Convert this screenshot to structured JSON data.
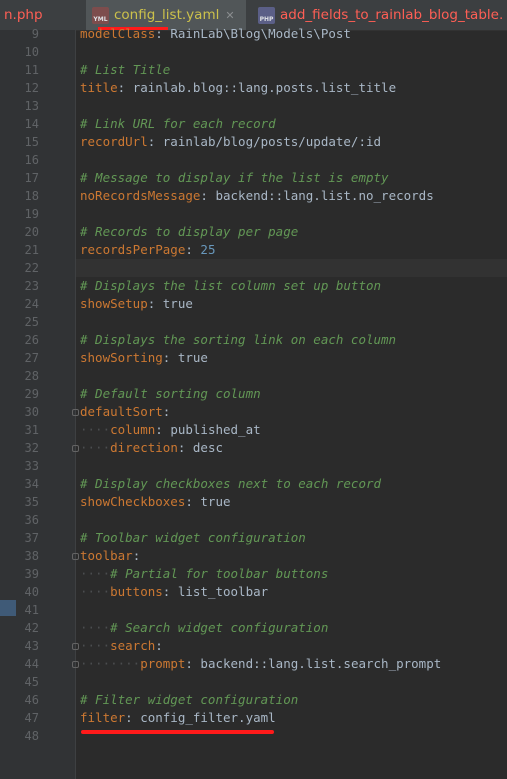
{
  "tabs": [
    {
      "label": "n.php",
      "icon": "php-file-icon"
    },
    {
      "label": "config_list.yaml",
      "icon": "yaml-file-icon",
      "active": true
    },
    {
      "label": "add_fields_to_rainlab_blog_table.",
      "icon": "php-file-icon"
    }
  ],
  "editor": {
    "current_line": 22,
    "lines": [
      {
        "n": "9",
        "parts": [
          [
            "key",
            "modelClass"
          ],
          [
            "val",
            ": RainLab\\Blog\\Models\\Post"
          ]
        ]
      },
      {
        "n": "10",
        "parts": []
      },
      {
        "n": "11",
        "parts": [
          [
            "comment",
            "# List Title"
          ]
        ]
      },
      {
        "n": "12",
        "parts": [
          [
            "key",
            "title"
          ],
          [
            "val",
            ": rainlab.blog::lang.posts.list_title"
          ]
        ]
      },
      {
        "n": "13",
        "parts": []
      },
      {
        "n": "14",
        "parts": [
          [
            "comment",
            "# Link URL for each record"
          ]
        ]
      },
      {
        "n": "15",
        "parts": [
          [
            "key",
            "recordUrl"
          ],
          [
            "val",
            ": rainlab/blog/posts/update/:id"
          ]
        ]
      },
      {
        "n": "16",
        "parts": []
      },
      {
        "n": "17",
        "parts": [
          [
            "comment",
            "# Message to display if the list is empty"
          ]
        ]
      },
      {
        "n": "18",
        "parts": [
          [
            "key",
            "noRecordsMessage"
          ],
          [
            "val",
            ": backend::lang.list.no_records"
          ]
        ]
      },
      {
        "n": "19",
        "parts": []
      },
      {
        "n": "20",
        "parts": [
          [
            "comment",
            "# Records to display per page"
          ]
        ]
      },
      {
        "n": "21",
        "parts": [
          [
            "key",
            "recordsPerPage"
          ],
          [
            "val",
            ": "
          ],
          [
            "num",
            "25"
          ]
        ]
      },
      {
        "n": "22",
        "parts": []
      },
      {
        "n": "23",
        "parts": [
          [
            "comment",
            "# Displays the list column set up button"
          ]
        ]
      },
      {
        "n": "24",
        "parts": [
          [
            "key",
            "showSetup"
          ],
          [
            "val",
            ": true"
          ]
        ]
      },
      {
        "n": "25",
        "parts": []
      },
      {
        "n": "26",
        "parts": [
          [
            "comment",
            "# Displays the sorting link on each column"
          ]
        ]
      },
      {
        "n": "27",
        "parts": [
          [
            "key",
            "showSorting"
          ],
          [
            "val",
            ": true"
          ]
        ]
      },
      {
        "n": "28",
        "parts": []
      },
      {
        "n": "29",
        "parts": [
          [
            "comment",
            "# Default sorting column"
          ]
        ]
      },
      {
        "n": "30",
        "parts": [
          [
            "key",
            "defaultSort"
          ],
          [
            "val",
            ":"
          ]
        ]
      },
      {
        "n": "31",
        "parts": [
          [
            "dots",
            "····"
          ],
          [
            "key",
            "column"
          ],
          [
            "val",
            ": published_at"
          ]
        ]
      },
      {
        "n": "32",
        "parts": [
          [
            "dots",
            "····"
          ],
          [
            "key",
            "direction"
          ],
          [
            "val",
            ": desc"
          ]
        ]
      },
      {
        "n": "33",
        "parts": []
      },
      {
        "n": "34",
        "parts": [
          [
            "comment",
            "# Display checkboxes next to each record"
          ]
        ]
      },
      {
        "n": "35",
        "parts": [
          [
            "key",
            "showCheckboxes"
          ],
          [
            "val",
            ": true"
          ]
        ]
      },
      {
        "n": "36",
        "parts": []
      },
      {
        "n": "37",
        "parts": [
          [
            "comment",
            "# Toolbar widget configuration"
          ]
        ]
      },
      {
        "n": "38",
        "parts": [
          [
            "key",
            "toolbar"
          ],
          [
            "val",
            ":"
          ]
        ]
      },
      {
        "n": "39",
        "parts": [
          [
            "dots",
            "····"
          ],
          [
            "comment",
            "# Partial for toolbar buttons"
          ]
        ]
      },
      {
        "n": "40",
        "parts": [
          [
            "dots",
            "····"
          ],
          [
            "key",
            "buttons"
          ],
          [
            "val",
            ": list_toolbar"
          ]
        ]
      },
      {
        "n": "41",
        "parts": []
      },
      {
        "n": "42",
        "parts": [
          [
            "dots",
            "····"
          ],
          [
            "comment",
            "# Search widget configuration"
          ]
        ]
      },
      {
        "n": "43",
        "parts": [
          [
            "dots",
            "····"
          ],
          [
            "key",
            "search"
          ],
          [
            "val",
            ":"
          ]
        ]
      },
      {
        "n": "44",
        "parts": [
          [
            "dots",
            "········"
          ],
          [
            "key",
            "prompt"
          ],
          [
            "val",
            ": backend::lang.list.search_prompt"
          ]
        ]
      },
      {
        "n": "45",
        "parts": []
      },
      {
        "n": "46",
        "parts": [
          [
            "comment",
            "# Filter widget configuration"
          ]
        ]
      },
      {
        "n": "47",
        "parts": [
          [
            "key",
            "filter"
          ],
          [
            "val",
            ": config_filter.yaml"
          ]
        ]
      },
      {
        "n": "48",
        "parts": []
      }
    ]
  }
}
